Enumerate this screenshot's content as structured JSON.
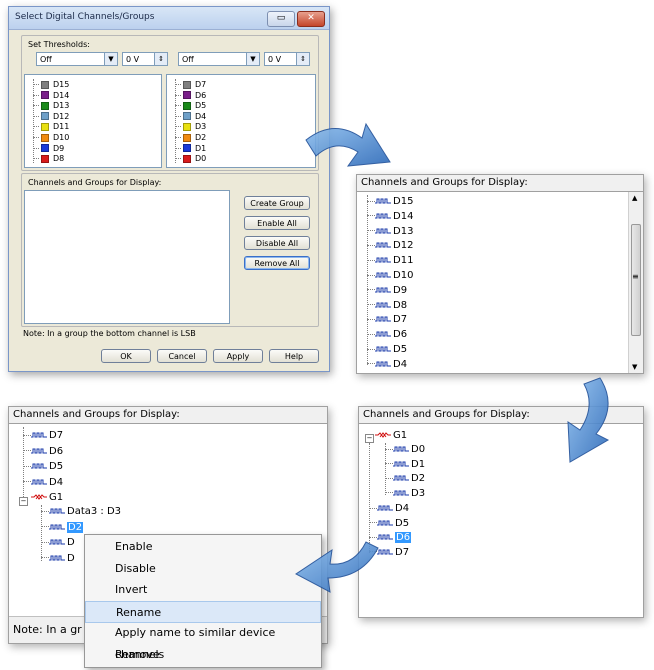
{
  "dialog": {
    "title": "Select Digital Channels/Groups",
    "thresholds_label": "Set Thresholds:",
    "left_threshold": {
      "mode": "Off",
      "voltage": "0 V"
    },
    "right_threshold": {
      "mode": "Off",
      "voltage": "0 V"
    },
    "left_channels": [
      {
        "label": "D15",
        "color": "#808080"
      },
      {
        "label": "D14",
        "color": "#7a1f8a"
      },
      {
        "label": "D13",
        "color": "#1a8a1a"
      },
      {
        "label": "D12",
        "color": "#6fa0c8"
      },
      {
        "label": "D11",
        "color": "#e8e010"
      },
      {
        "label": "D10",
        "color": "#f08a10"
      },
      {
        "label": "D9",
        "color": "#1a3ad8"
      },
      {
        "label": "D8",
        "color": "#d81a1a"
      }
    ],
    "right_channels": [
      {
        "label": "D7",
        "color": "#808080"
      },
      {
        "label": "D6",
        "color": "#7a1f8a"
      },
      {
        "label": "D5",
        "color": "#1a8a1a"
      },
      {
        "label": "D4",
        "color": "#6fa0c8"
      },
      {
        "label": "D3",
        "color": "#e8e010"
      },
      {
        "label": "D2",
        "color": "#f08a10"
      },
      {
        "label": "D1",
        "color": "#1a3ad8"
      },
      {
        "label": "D0",
        "color": "#d81a1a"
      }
    ],
    "display_label": "Channels and Groups for Display:",
    "buttons": {
      "create_group": "Create Group",
      "enable_all": "Enable All",
      "disable_all": "Disable All",
      "remove_all": "Remove All"
    },
    "note": "Note: In a group the bottom channel is LSB",
    "footer": {
      "ok": "OK",
      "cancel": "Cancel",
      "apply": "Apply",
      "help": "Help"
    }
  },
  "panel_a": {
    "title": "Channels and Groups for Display:",
    "items": [
      "D15",
      "D14",
      "D13",
      "D12",
      "D11",
      "D10",
      "D9",
      "D8",
      "D7",
      "D6",
      "D5",
      "D4"
    ]
  },
  "panel_b": {
    "title": "Channels and Groups for Display:",
    "items": [
      "D7",
      "D6",
      "D5",
      "D4"
    ],
    "group": "G1",
    "group_children": [
      "Data3 : D3",
      "D2",
      "D",
      "D"
    ],
    "note": "Note: In a gr"
  },
  "context_menu": {
    "items": [
      "Enable",
      "Disable",
      "Invert",
      "Rename",
      "Apply name to similar device channels",
      "Remove"
    ]
  },
  "panel_c": {
    "title": "Channels and Groups for Display:",
    "group": "G1",
    "group_children": [
      "D0",
      "D1",
      "D2",
      "D3"
    ],
    "items": [
      "D4",
      "D5",
      "D6",
      "D7"
    ]
  },
  "colors": {
    "selection": "#3399ff",
    "arrow": "#3a78c8",
    "group_icon": "#d01010"
  }
}
